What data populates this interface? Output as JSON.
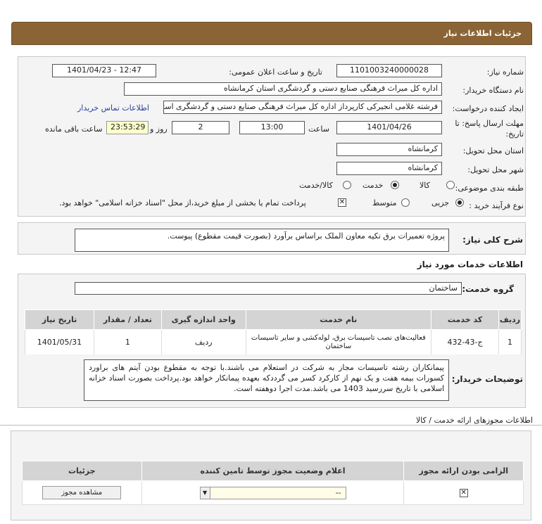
{
  "header": {
    "title": "جزئیات اطلاعات نیاز"
  },
  "form": {
    "need_number_label": "شماره نیاز:",
    "need_number": "1101003240000028",
    "announce_label": "تاریخ و ساعت اعلان عمومی:",
    "announce_value": "1401/04/23 - 12:47",
    "buyer_org_label": "نام دستگاه خریدار:",
    "buyer_org": "اداره کل میراث فرهنگی  صنایع دستی و گردشگری استان کرمانشاه",
    "creator_label": "ایجاد کننده درخواست:",
    "creator": "فرشته غلامی انجیرکی کارپرداز اداره کل میراث فرهنگی  صنایع دستی و گردشگری استان کرمانشاه",
    "contact_link": "اطلاعات تماس خریدار",
    "deadline_label_1": "مهلت ارسال پاسخ: تا",
    "deadline_label_2": "تاریخ:",
    "deadline_date": "1401/04/26",
    "time_label": "ساعت",
    "deadline_time": "13:00",
    "days_value": "2",
    "days_label": "روز و",
    "remaining_time": "23:53:29",
    "remaining_label": "ساعت باقی مانده",
    "province_label": "استان محل تحویل:",
    "province": "کرمانشاه",
    "city_label": "شهر محل تحویل:",
    "city": "کرمانشاه",
    "category_label": "طبقه بندی موضوعی:",
    "category_options": [
      "کالا",
      "خدمت",
      "کالا/خدمت"
    ],
    "category_selected": "خدمت",
    "process_label": "نوع فرآیند خرید :",
    "process_options": [
      "جزیی",
      "متوسط"
    ],
    "process_selected": "جزیی",
    "payment_note": "پرداخت تمام یا بخشی از مبلغ خرید،از محل \"اسناد خزانه اسلامی\" خواهد بود."
  },
  "summary": {
    "label": "شرح کلی نیاز:",
    "text": "پروژه تعمیرات برق تکیه معاون الملک براساس برآورد (بصورت قیمت مقطوع) پیوست."
  },
  "services": {
    "section_title": "اطلاعات خدمات مورد نیاز",
    "group_label": "گروه خدمت:",
    "group_value": "ساختمان",
    "columns": [
      "ردیف",
      "کد خدمت",
      "نام خدمت",
      "واحد اندازه گیری",
      "تعداد / مقدار",
      "تاریخ نیاز"
    ],
    "rows": [
      {
        "row": "1",
        "code": "ج-43-432",
        "name": "فعالیت‌های نصب تاسیسات برق، لوله‌کشی و سایر تاسیسات ساختمان",
        "unit": "ردیف",
        "qty": "1",
        "date": "1401/05/31"
      }
    ]
  },
  "buyer_notes": {
    "label": "توضیحات خریدار:",
    "text": "پیمانکاران رشته تاسیسات مجاز به شرکت در استعلام می باشند.با توجه به مقطوع بودن آیتم های براورد کسورات بیمه هفت و یک نهم از کارکرد کسر می گرددکه بعهده پیمانکار خواهد بود.پرداخت بصورت اسناد خزانه اسلامی با تاریخ سررسید 1403 می باشد.مدت اجرا دوهفته است."
  },
  "permits": {
    "section_title": "اطلاعات مجوزهای ارائه خدمت / کالا",
    "columns": [
      "الزامی بودن ارائه مجوز",
      "اعلام وضعیت مجوز توسط تامین کننده",
      "جزئیات"
    ],
    "select_value": "--",
    "view_button": "مشاهده مجوز"
  },
  "colors": {
    "header": "#8b6436",
    "link": "#2a3f9e",
    "table_header": "#d4d4d4"
  }
}
